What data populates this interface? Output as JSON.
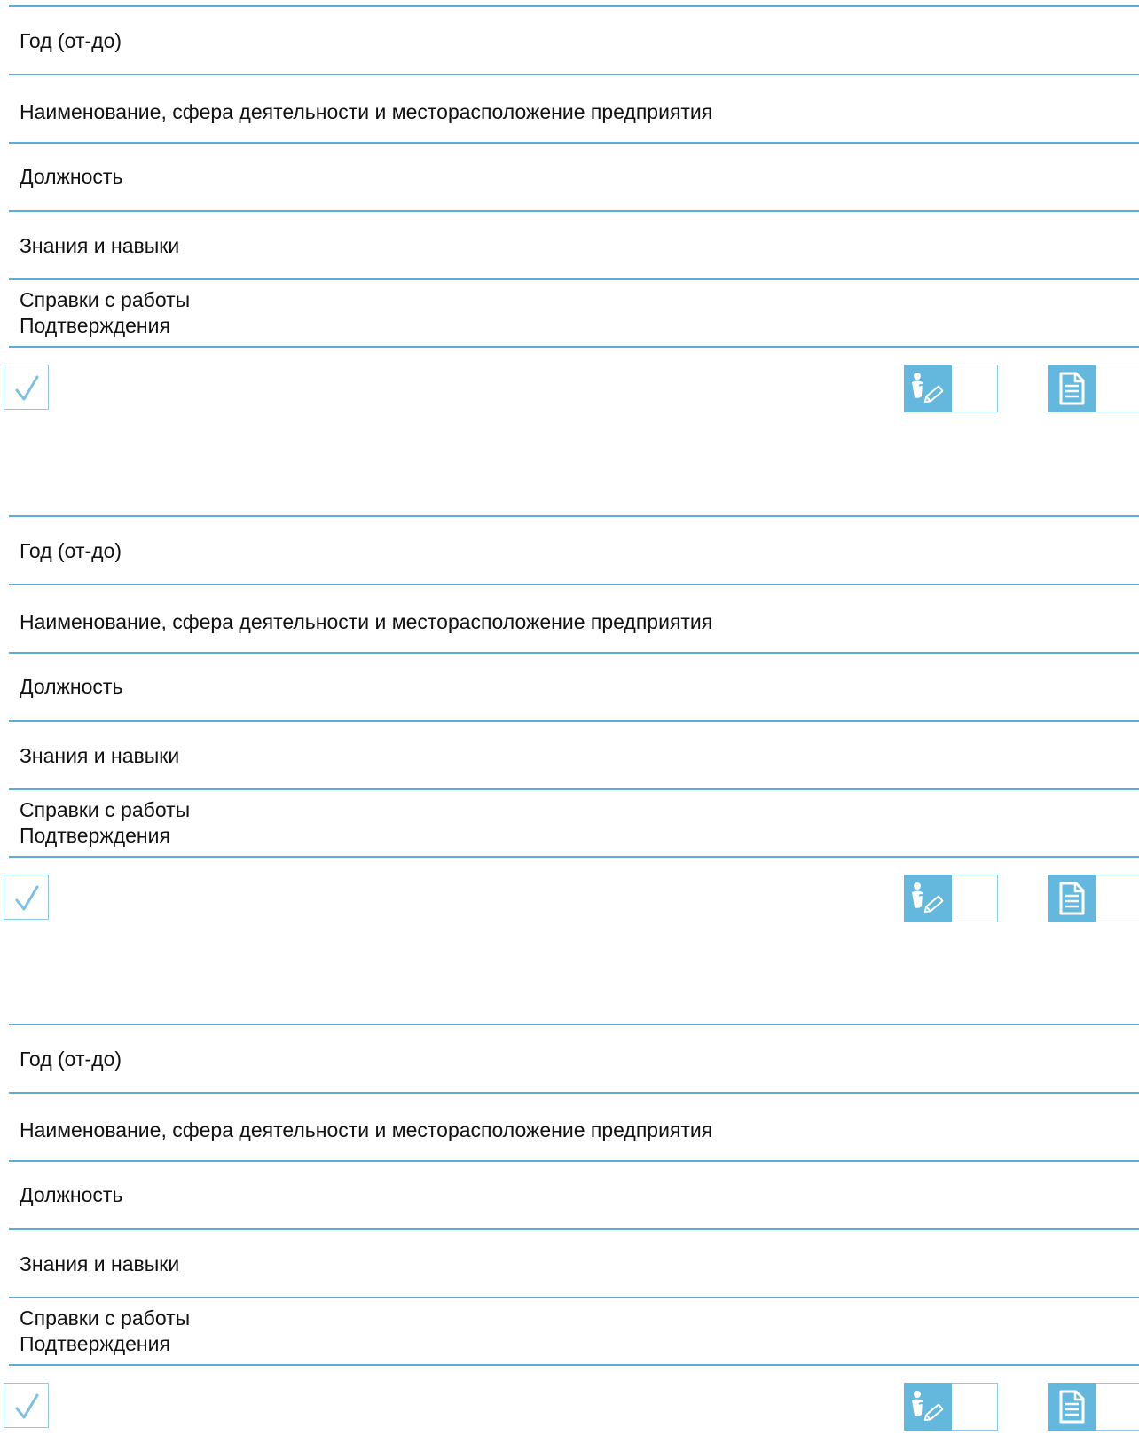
{
  "entries": [
    {
      "year_label": "Год (от-до)",
      "company_label": "Наименование, сфера деятельности и месторасположение предприятия",
      "position_label": "Должность",
      "skills_label": "Знания и навыки",
      "references_label_line1": "Справки с работы",
      "references_label_line2": "Подтверждения"
    },
    {
      "year_label": "Год (от-до)",
      "company_label": "Наименование, сфера деятельности и месторасположение предприятия",
      "position_label": "Должность",
      "skills_label": "Знания и навыки",
      "references_label_line1": "Справки с работы",
      "references_label_line2": "Подтверждения"
    },
    {
      "year_label": "Год (от-до)",
      "company_label": "Наименование, сфера деятельности и месторасположение предприятия",
      "position_label": "Должность",
      "skills_label": "Знания и навыки",
      "references_label_line1": "Справки с работы",
      "references_label_line2": "Подтверждения"
    }
  ],
  "icons": {
    "checkbox": "checkmark-icon",
    "editor": "person-pencil-icon",
    "document": "document-icon"
  },
  "colors": {
    "rule": "#5aaed8",
    "icon_tile": "#64b8de",
    "check": "#7cc1e4"
  }
}
